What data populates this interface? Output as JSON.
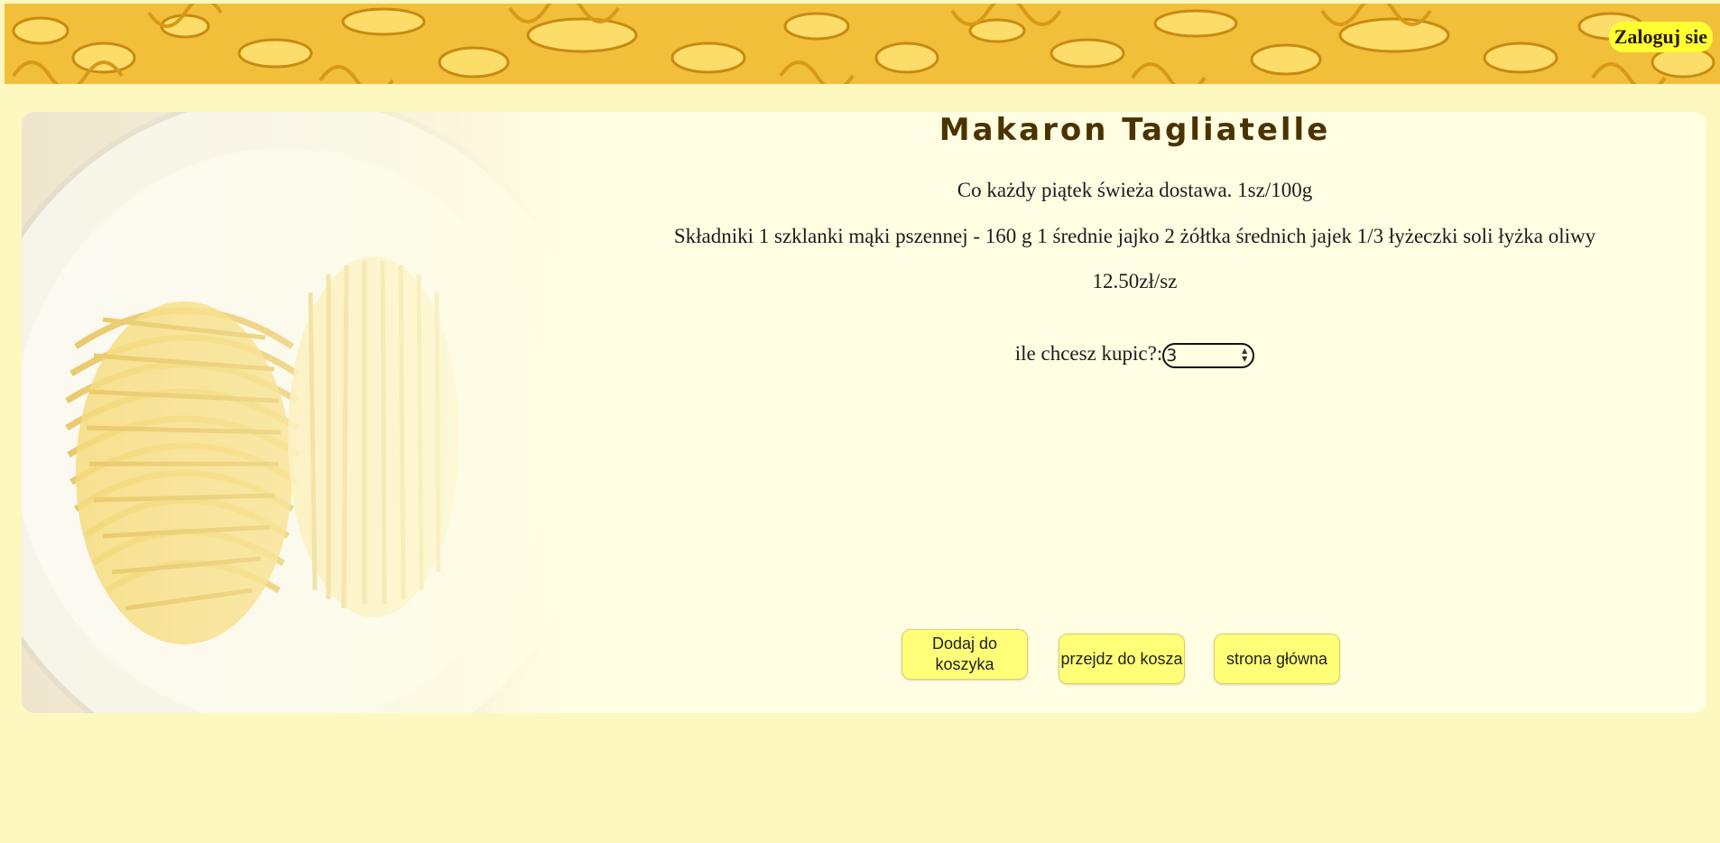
{
  "header": {
    "login_label": "Zaloguj sie"
  },
  "product": {
    "title": "Makaron Tagliatelle",
    "delivery_text": "Co każdy piątek świeża dostawa. 1sz/100g",
    "ingredients_text": "Składniki 1 szklanki mąki pszennej - 160 g 1 średnie jajko 2 żółtka średnich jajek 1/3 łyżeczki soli łyżka oliwy",
    "price_text": "12.50zł/sz"
  },
  "order": {
    "quantity_label": "ile chcesz kupic?:",
    "quantity_value": "3"
  },
  "actions": {
    "add_to_cart": "Dodaj do koszyka",
    "go_to_cart": "przejdz do kosza",
    "home_page": "strona główna"
  },
  "icons": {
    "spinner": "number-stepper-icon"
  },
  "colors": {
    "page_background": "#fdf8bf",
    "panel_background": "#fffde2",
    "button_background": "#ffff78",
    "login_background": "#ffff33",
    "title_color": "#4b3300"
  }
}
